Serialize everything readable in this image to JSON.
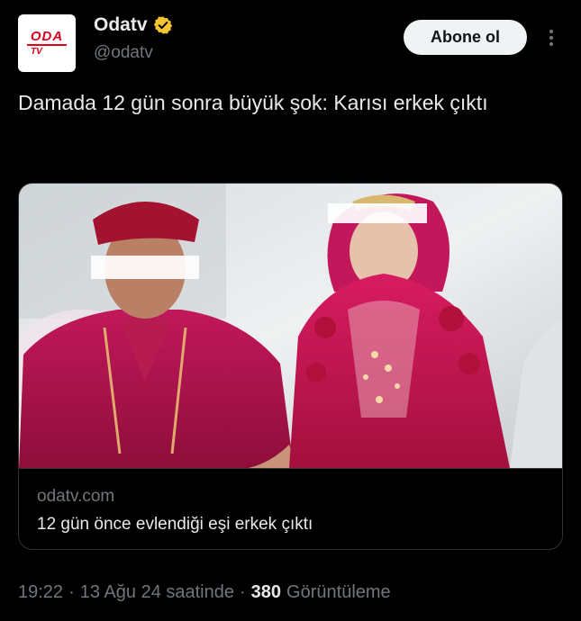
{
  "author": {
    "display_name": "Odatv",
    "handle": "@odatv",
    "avatar_logo_top": "ODA",
    "avatar_logo_bottom": "TV",
    "verified_icon": "verified-badge-icon",
    "verified_color": "#f4c431"
  },
  "actions": {
    "follow_label": "Abone ol",
    "more_icon": "more-options-icon"
  },
  "tweet": {
    "text": "Damada 12 gün sonra büyük şok: Karısı erkek çıktı"
  },
  "link_card": {
    "domain": "odatv.com",
    "title": "12 gün önce evlendiği eşi erkek çıktı"
  },
  "meta": {
    "time": "19:22",
    "separator": "·",
    "date": "13 Ağu 24 saatinde",
    "views": "380",
    "views_label": "Görüntüleme"
  },
  "colors": {
    "background": "#000000",
    "text_primary": "#e7e9ea",
    "text_secondary": "#71767b",
    "border": "#2f3336",
    "button_bg": "#eff3f4",
    "brand_red": "#e3001b"
  }
}
